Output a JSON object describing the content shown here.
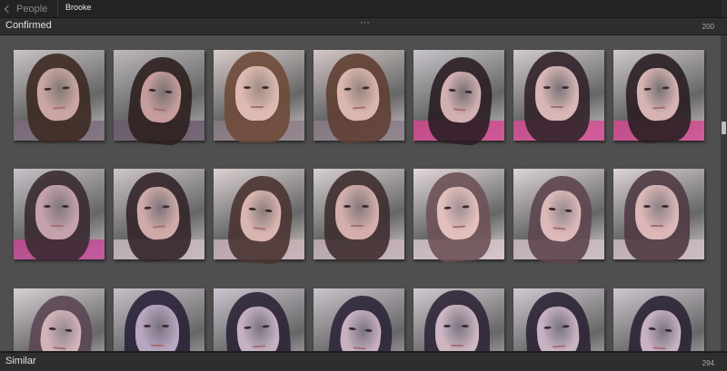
{
  "nav": {
    "back_label": "People",
    "breadcrumb": "Brooke"
  },
  "confirmed": {
    "title": "Confirmed",
    "menu": "···",
    "count": "200"
  },
  "similar": {
    "title": "Similar",
    "count": "294"
  },
  "thumbnails": [
    {
      "bg": "#c9c4c6",
      "skin": "#caa6a2",
      "hair": "#3d2a24",
      "shirt": "#7a6a78"
    },
    {
      "bg": "#bdb8bc",
      "skin": "#c59d9c",
      "hair": "#2e201f",
      "shirt": "#6b5c6c"
    },
    {
      "bg": "#d8ccca",
      "skin": "#dcbab2",
      "hair": "#6e4a3a",
      "shirt": "#8b7c86"
    },
    {
      "bg": "#d4c8c6",
      "skin": "#d9b6ae",
      "hair": "#5f3f33",
      "shirt": "#8a7b86"
    },
    {
      "bg": "#c9c5cb",
      "skin": "#d2b0b2",
      "hair": "#2a1e24",
      "shirt": "#d0488e"
    },
    {
      "bg": "#d2cbcf",
      "skin": "#d8b6b6",
      "hair": "#32242a",
      "shirt": "#d24c93"
    },
    {
      "bg": "#d0c9cc",
      "skin": "#d6b3b2",
      "hair": "#2a1f24",
      "shirt": "#cf4a8f"
    },
    {
      "bg": "#c9c2c8",
      "skin": "#c5a2ab",
      "hair": "#3a2a32",
      "shirt": "#c44a95"
    },
    {
      "bg": "#cec6ca",
      "skin": "#cfaaa9",
      "hair": "#33262a",
      "shirt": "#c8b7bf"
    },
    {
      "bg": "#dcd2d2",
      "skin": "#d9b4b0",
      "hair": "#4a3432",
      "shirt": "#c6b0b6"
    },
    {
      "bg": "#d8d0d1",
      "skin": "#d3aeab",
      "hair": "#3f2e2f",
      "shirt": "#c4b0b8"
    },
    {
      "bg": "#e3d9da",
      "skin": "#e2bfbc",
      "hair": "#6e5258",
      "shirt": "#d3c2c8"
    },
    {
      "bg": "#ded5d7",
      "skin": "#dcb9b8",
      "hair": "#5d4550",
      "shirt": "#cdbcc2"
    },
    {
      "bg": "#ddd4d6",
      "skin": "#dbb7b7",
      "hair": "#4f3a44",
      "shirt": "#cbb9c1"
    },
    {
      "bg": "#d8d0d5",
      "skin": "#d1b3b8",
      "hair": "#5b4654",
      "shirt": "#c8b8c2"
    },
    {
      "bg": "#c6bfc8",
      "skin": "#b7a7c0",
      "hair": "#2a2238",
      "shirt": "#a89ab8"
    },
    {
      "bg": "#cbc4cf",
      "skin": "#c5b1c3",
      "hair": "#2c2336",
      "shirt": "#a497b7"
    },
    {
      "bg": "#cbc3cd",
      "skin": "#c7b0c0",
      "hair": "#2e253a",
      "shirt": "#a99ab9"
    },
    {
      "bg": "#d2cbd2",
      "skin": "#cdb5c2",
      "hair": "#2f2638",
      "shirt": "#aa9fbd"
    },
    {
      "bg": "#d0c9d2",
      "skin": "#c9b2c3",
      "hair": "#2c2436",
      "shirt": "#a89abb"
    },
    {
      "bg": "#cec7d0",
      "skin": "#c8b1c2",
      "hair": "#2b2335",
      "shirt": "#a697b9"
    }
  ]
}
